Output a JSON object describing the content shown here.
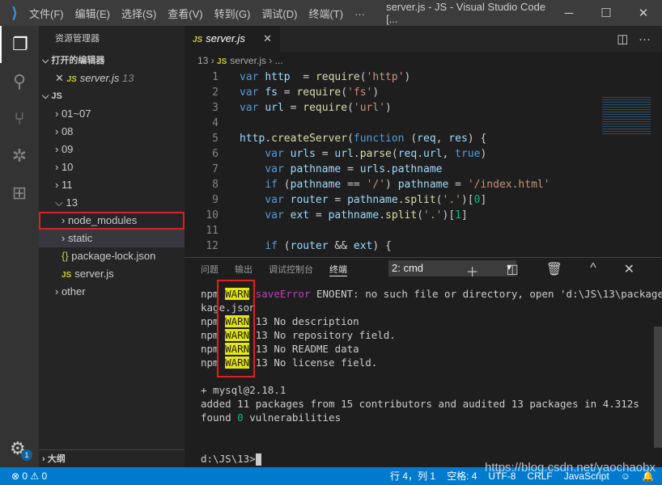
{
  "titlebar": {
    "menus": [
      "文件(F)",
      "编辑(E)",
      "选择(S)",
      "查看(V)",
      "转到(G)",
      "调试(D)",
      "终端(T)",
      "···"
    ],
    "title": "server.js - JS - Visual Studio Code [..."
  },
  "sidebar": {
    "title": "资源管理器",
    "open_editors": "打开的编辑器",
    "open_file": "server.js",
    "open_file_badge": "13",
    "root": "JS",
    "tree": [
      "01~07",
      "08",
      "09",
      "10",
      "11",
      "13",
      "node_modules",
      "static",
      "package-lock.json",
      "server.js",
      "other"
    ],
    "outline": "大纲"
  },
  "editor": {
    "tab": "server.js",
    "breadcrumb": [
      "13",
      "server.js",
      "..."
    ],
    "lines": [
      [
        [
          "k",
          "var "
        ],
        [
          "v",
          "http"
        ],
        [
          "",
          "  = "
        ],
        [
          "f",
          "require"
        ],
        [
          "",
          "("
        ],
        [
          "s",
          "'http'"
        ],
        [
          "",
          ")"
        ]
      ],
      [
        [
          "k",
          "var "
        ],
        [
          "v",
          "fs"
        ],
        [
          "",
          "",
          " = "
        ],
        [
          "f",
          "require"
        ],
        [
          "",
          "("
        ],
        [
          "s",
          "'fs'"
        ],
        [
          "",
          ")"
        ]
      ],
      [
        [
          "k",
          "var "
        ],
        [
          "v",
          "url"
        ],
        [
          "",
          " = "
        ],
        [
          "f",
          "require"
        ],
        [
          "",
          "("
        ],
        [
          "s",
          "'url'"
        ],
        [
          "",
          ")"
        ]
      ],
      [],
      [
        [
          "v",
          "http"
        ],
        [
          "",
          "."
        ],
        [
          "f",
          "createServer"
        ],
        [
          "",
          "("
        ],
        [
          "k",
          "function"
        ],
        [
          "",
          " ("
        ],
        [
          "v",
          "req"
        ],
        [
          "",
          ", "
        ],
        [
          "v",
          "res"
        ],
        [
          "",
          ") {"
        ]
      ],
      [
        [
          "",
          "    "
        ],
        [
          "k",
          "var "
        ],
        [
          "v",
          "urls"
        ],
        [
          "",
          " = "
        ],
        [
          "v",
          "url"
        ],
        [
          "",
          "."
        ],
        [
          "f",
          "parse"
        ],
        [
          "",
          "("
        ],
        [
          "v",
          "req"
        ],
        [
          "",
          "."
        ],
        [
          "v",
          "url"
        ],
        [
          "",
          ", "
        ],
        [
          "k",
          "true"
        ],
        [
          "",
          ")"
        ]
      ],
      [
        [
          "",
          "    "
        ],
        [
          "k",
          "var "
        ],
        [
          "v",
          "pathname"
        ],
        [
          "",
          " = "
        ],
        [
          "v",
          "urls"
        ],
        [
          "",
          "."
        ],
        [
          "v",
          "pathname"
        ]
      ],
      [
        [
          "",
          "    "
        ],
        [
          "k",
          "if"
        ],
        [
          "",
          " ("
        ],
        [
          "v",
          "pathname"
        ],
        [
          "",
          " == "
        ],
        [
          "s",
          "'/'"
        ],
        [
          "",
          ") "
        ],
        [
          "v",
          "pathname"
        ],
        [
          "",
          " = "
        ],
        [
          "s",
          "'/index.html'"
        ]
      ],
      [
        [
          "",
          "    "
        ],
        [
          "k",
          "var "
        ],
        [
          "v",
          "router"
        ],
        [
          "",
          " = "
        ],
        [
          "v",
          "pathname"
        ],
        [
          "",
          "."
        ],
        [
          "f",
          "split"
        ],
        [
          "",
          "("
        ],
        [
          "s",
          "'.'"
        ],
        [
          "",
          ")["
        ],
        [
          "grn",
          "0"
        ],
        [
          "",
          "]"
        ]
      ],
      [
        [
          "",
          "    "
        ],
        [
          "k",
          "var "
        ],
        [
          "v",
          "ext"
        ],
        [
          "",
          " = "
        ],
        [
          "v",
          "pathname"
        ],
        [
          "",
          "."
        ],
        [
          "f",
          "split"
        ],
        [
          "",
          "("
        ],
        [
          "s",
          "'.'"
        ],
        [
          "",
          ")["
        ],
        [
          "grn",
          "1"
        ],
        [
          "",
          "]"
        ]
      ],
      [],
      [
        [
          "",
          "    "
        ],
        [
          "k",
          "if"
        ],
        [
          "",
          " ("
        ],
        [
          "v",
          "router"
        ],
        [
          "",
          " && "
        ],
        [
          "v",
          "ext"
        ],
        [
          "",
          ") {"
        ]
      ]
    ]
  },
  "panel": {
    "tabs": [
      "问题",
      "输出",
      "调试控制台",
      "终端"
    ],
    "terminal_select": "2: cmd",
    "lines": [
      [
        [
          "",
          "npm "
        ],
        [
          "warn",
          "WARN"
        ],
        [
          "mag",
          " saveError"
        ],
        [
          "",
          " ENOENT: no such file or directory, open 'd:\\JS\\13\\package"
        ]
      ],
      [
        [
          "",
          "kage.json"
        ]
      ],
      [
        [
          "",
          "npm "
        ],
        [
          "warn",
          "WARN"
        ],
        [
          "",
          " 13 No description"
        ]
      ],
      [
        [
          "",
          "npm "
        ],
        [
          "warn",
          "WARN"
        ],
        [
          "",
          " 13 No repository field."
        ]
      ],
      [
        [
          "",
          "npm "
        ],
        [
          "warn",
          "WARN"
        ],
        [
          "",
          " 13 No README data"
        ]
      ],
      [
        [
          "",
          "npm "
        ],
        [
          "warn",
          "WARN"
        ],
        [
          "",
          " 13 No license field."
        ]
      ],
      [],
      [
        [
          "",
          "+ mysql@2.18.1"
        ]
      ],
      [
        [
          "",
          "added 11 packages from 15 contributors and audited 13 packages in 4.312s"
        ]
      ],
      [
        [
          "",
          "found "
        ],
        [
          "grn",
          "0"
        ],
        [
          "",
          " vulnerabilities"
        ]
      ],
      [],
      [],
      [
        [
          "",
          "d:\\JS\\13>"
        ]
      ]
    ]
  },
  "status": {
    "errors": "0",
    "warnings": "0",
    "position": "行 4，列 1",
    "spaces": "空格: 4",
    "encoding": "UTF-8",
    "eol": "CRLF",
    "language": "JavaScript",
    "watermark": "https://blog.csdn.net/yaochaobx",
    "settings_badge": "1"
  },
  "colors": {
    "statusbar": "#007acc",
    "warn_bg": "#e5e510",
    "highlight_box": "#e02020"
  }
}
